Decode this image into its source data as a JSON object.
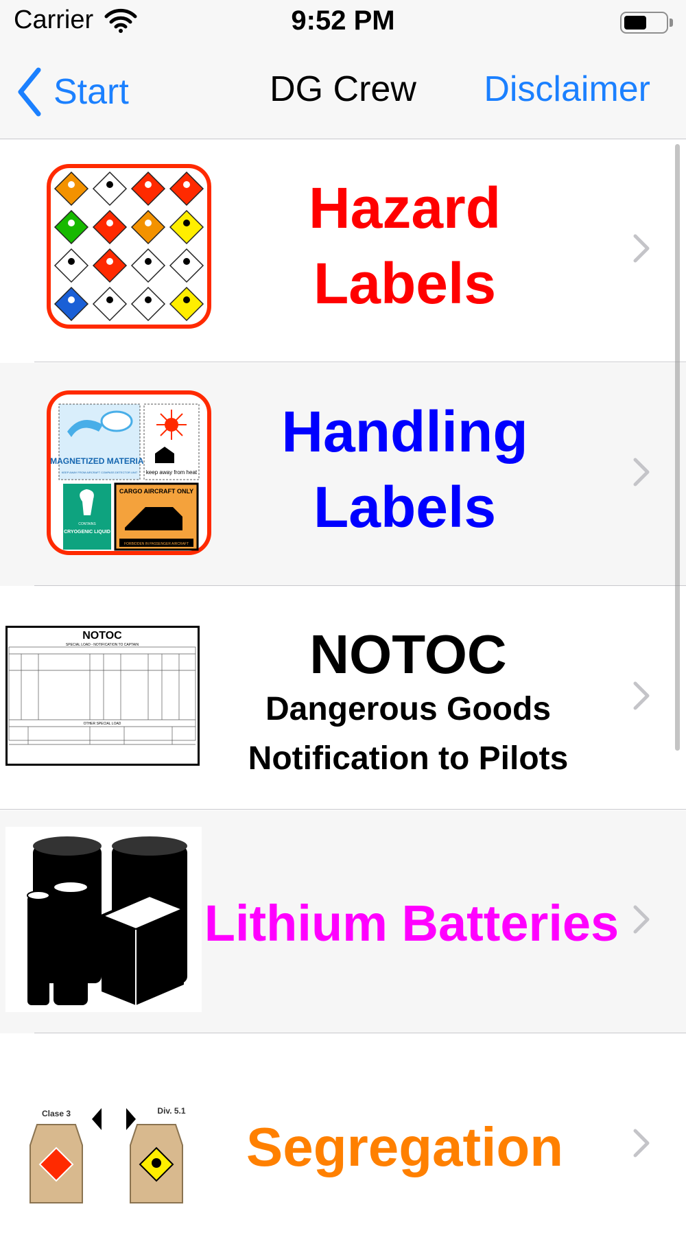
{
  "status_bar": {
    "carrier": "Carrier",
    "time": "9:52 PM",
    "battery_level": 0.55
  },
  "nav": {
    "back_label": "Start",
    "title": "DG Crew",
    "right_button": "Disclaimer"
  },
  "rows": [
    {
      "line1": "Hazard",
      "line2": "Labels",
      "color": "#ff0000",
      "icon": "hazard-labels-icon"
    },
    {
      "line1": "Handling",
      "line2": "Labels",
      "color": "#0000ff",
      "icon": "handling-labels-icon",
      "icon_texts": {
        "magnet_title": "MAGNETIZED MATERIAL",
        "magnet_sub": "KEEP AWAY FROM AIRCRAFT COMPASS DETECTOR UNIT",
        "heat": "keep away from heat",
        "cryo_top": "CONTAINS",
        "cryo": "CRYOGENIC LIQUID",
        "cargo": "CARGO AIRCRAFT ONLY",
        "cargo_sub": "FORBIDDEN IN PASSENGER AIRCRAFT"
      }
    },
    {
      "title": "NOTOC",
      "line1": "Dangerous Goods",
      "line2": "Notification to Pilots",
      "color": "#000000",
      "icon": "notoc-document-icon",
      "doc_texts": {
        "title": "NOTOC",
        "subtitle": "SPECIAL LOAD - NOTIFICATION TO CAPTAIN",
        "mid": "OTHER SPECIAL LOAD"
      }
    },
    {
      "line1": "Lithium Batteries",
      "color": "#ff00ff",
      "icon": "lithium-batteries-icon"
    },
    {
      "line1": "Segregation",
      "color": "#ff8000",
      "icon": "segregation-icon",
      "icon_texts": {
        "left": "Clase 3",
        "right": "Div. 5.1"
      }
    }
  ],
  "colors": {
    "accent": "#1b80ff",
    "hazard": "#ff0000",
    "handling": "#0000ff",
    "lithium": "#ff00ff",
    "segregation": "#ff8000"
  }
}
